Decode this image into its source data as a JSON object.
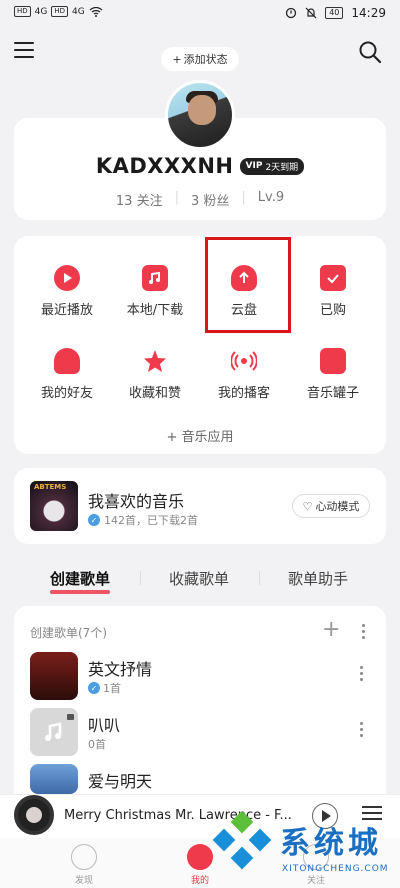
{
  "status": {
    "sim1": "HD",
    "sim2": "HD",
    "net1": "4G",
    "net2": "4G",
    "battery": "40",
    "time": "14:29"
  },
  "header": {
    "add_status": "添加状态"
  },
  "profile": {
    "username": "KADXXXNH",
    "vip_label": "2天到期",
    "vip_brand": "VIP",
    "follow": "13 关注",
    "fans": "3 粉丝",
    "level": "Lv.9"
  },
  "grid": [
    {
      "label": "最近播放",
      "icon": "play-icon",
      "color": "#ef3a4b"
    },
    {
      "label": "本地/下载",
      "icon": "local-music-icon",
      "color": "#ef3a4b"
    },
    {
      "label": "云盘",
      "icon": "cloud-upload-icon",
      "color": "#ef3a4b"
    },
    {
      "label": "已购",
      "icon": "purchased-bag-icon",
      "color": "#ef3a4b"
    },
    {
      "label": "我的好友",
      "icon": "friends-icon",
      "color": "#ef3a4b"
    },
    {
      "label": "收藏和赞",
      "icon": "star-icon",
      "color": "#ef3a4b"
    },
    {
      "label": "我的播客",
      "icon": "broadcast-icon",
      "color": "#ef3a4b"
    },
    {
      "label": "音乐罐子",
      "icon": "music-jar-icon",
      "color": "#ef3a4b"
    }
  ],
  "music_apps": "音乐应用",
  "favorite": {
    "title": "我喜欢的音乐",
    "sub": "142首，已下载2首",
    "heart_mode": "心动模式",
    "cover_text": "ABTEMS"
  },
  "tabs": [
    "创建歌单",
    "收藏歌单",
    "歌单助手"
  ],
  "playlists": {
    "header": "创建歌单(7个)",
    "items": [
      {
        "name": "英文抒情",
        "count": "1首",
        "verified": true
      },
      {
        "name": "叭叭",
        "count": "0首",
        "verified": false
      },
      {
        "name": "爱与明天",
        "count": "",
        "verified": false
      }
    ]
  },
  "player": {
    "title": "Merry Christmas Mr. Lawrence - F..."
  },
  "nav": [
    {
      "label": "发现"
    },
    {
      "label": "我的"
    },
    {
      "label": "关注"
    }
  ],
  "watermark": {
    "text": "系统城",
    "sub": "XITONGCHENG.COM"
  },
  "colors": {
    "accent": "#ef3a4b",
    "highlight_box": "#d9141b"
  }
}
